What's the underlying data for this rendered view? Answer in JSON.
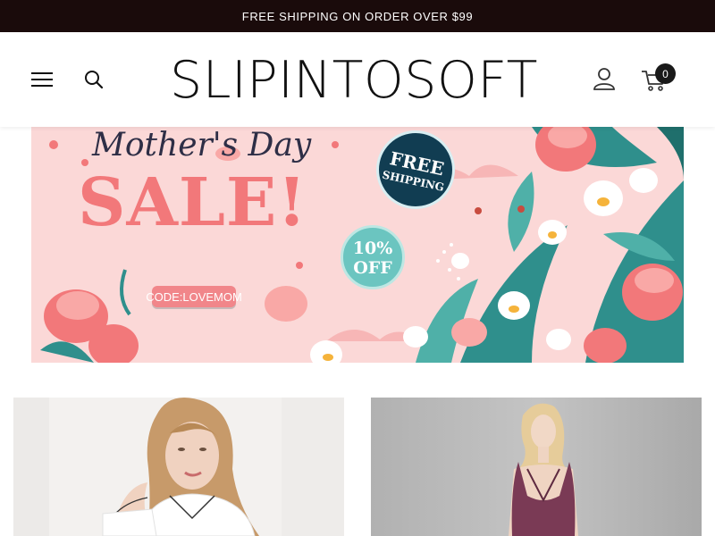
{
  "announcement": {
    "text": "FREE SHIPPING ON ORDER OVER $99"
  },
  "header": {
    "logo": "SLIPINTOSOFT",
    "cart_count": "0",
    "icons": [
      "menu-icon",
      "search-icon",
      "user-icon",
      "cart-icon"
    ]
  },
  "banner": {
    "script_text": "Mother's Day",
    "sale_text": "SALE!",
    "badge_free_line1": "FREE",
    "badge_free_line2": "SHIPPING",
    "badge_off_line1": "10%",
    "badge_off_line2": "OFF",
    "code_text": "CODE:LOVEMOM",
    "colors": {
      "background": "#fbd8d7",
      "sale": "#f2787a",
      "teal": "#2f8f8c",
      "navy": "#113d52"
    }
  },
  "products": [
    {
      "image": "woman-in-white-silk-pajamas"
    },
    {
      "image": "woman-in-purple-silk-nightgown"
    }
  ],
  "colors": {
    "announcement_bg": "#1a0b0b",
    "text": "#111111"
  }
}
